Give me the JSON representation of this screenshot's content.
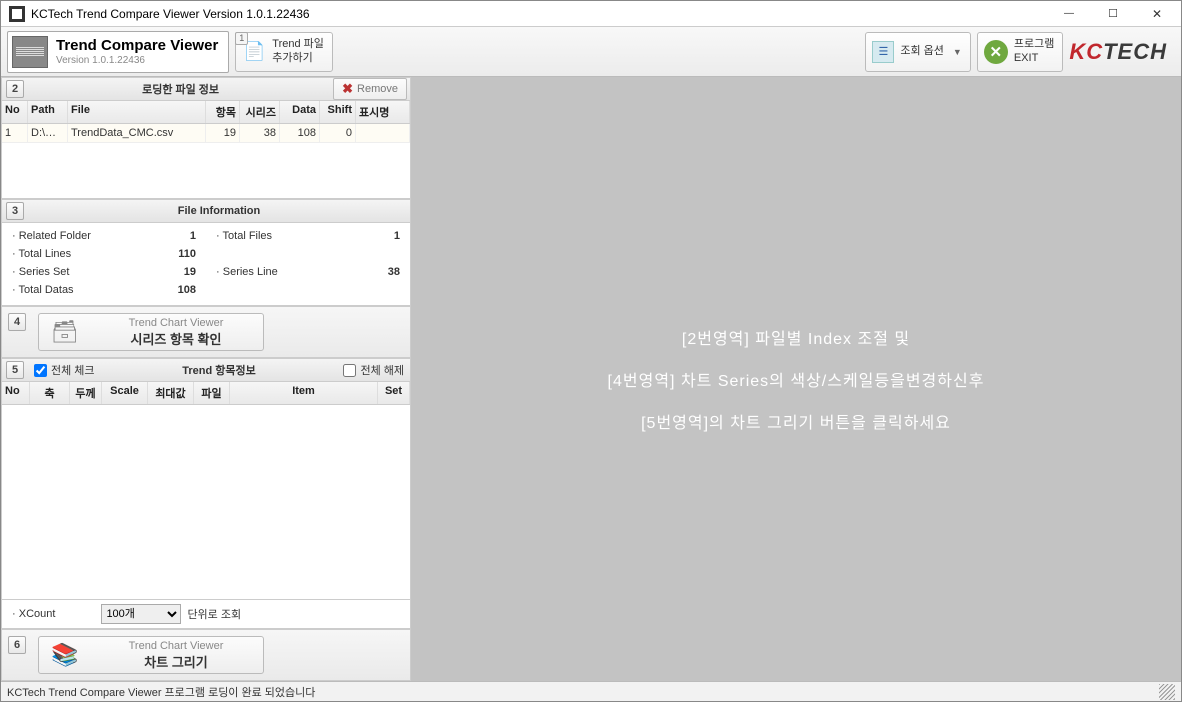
{
  "window": {
    "title": "KCTech Trend Compare Viewer Version 1.0.1.22436"
  },
  "toolbar": {
    "app_title": "Trend Compare Viewer",
    "app_version": "Version 1.0.1.22436",
    "add_file_btn_num": "1",
    "add_file_btn_label": "Trend 파일\n추가하기",
    "option_label": "조회 옵션",
    "exit_label": "프로그램\nEXIT",
    "brand_kc": "KC",
    "brand_tech": "TECH"
  },
  "panel2": {
    "num": "2",
    "title": "로딩한 파일 정보",
    "remove_label": "Remove",
    "headers": {
      "no": "No",
      "path": "Path",
      "file": "File",
      "item": "항목",
      "series": "시리즈",
      "data": "Data",
      "shift": "Shift",
      "display": "표시명"
    },
    "rows": [
      {
        "no": "1",
        "path": "D:\\…",
        "file": "TrendData_CMC.csv",
        "item": "19",
        "series": "38",
        "data": "108",
        "shift": "0",
        "display": ""
      }
    ]
  },
  "panel3": {
    "num": "3",
    "title": "File Information",
    "items": {
      "related_folder_label": "Related Folder",
      "related_folder_val": "1",
      "total_files_label": "Total Files",
      "total_files_val": "1",
      "total_lines_label": "Total Lines",
      "total_lines_val": "110",
      "series_set_label": "Series Set",
      "series_set_val": "19",
      "series_line_label": "Series Line",
      "series_line_val": "38",
      "total_datas_label": "Total Datas",
      "total_datas_val": "108"
    }
  },
  "panel4": {
    "num": "4",
    "viewer_label": "Trend Chart Viewer",
    "action_label": "시리즈 항목 확인"
  },
  "panel5": {
    "num": "5",
    "title": "Trend 항목정보",
    "check_all_label": "전체 체크",
    "uncheck_all_label": "전체 해제",
    "headers": {
      "no": "No",
      "axis": "축",
      "thickness": "두께",
      "scale": "Scale",
      "max": "최대값",
      "file": "파일",
      "item": "Item",
      "set": "Set"
    }
  },
  "xcount": {
    "label": "XCount",
    "selected": "100개",
    "suffix": "단위로 조회"
  },
  "panel6": {
    "num": "6",
    "viewer_label": "Trend Chart Viewer",
    "action_label": "차트 그리기"
  },
  "main_hints": {
    "line1": "[2번영역] 파일별 Index 조절 및",
    "line2": "[4번영역] 차트 Series의 색상/스케일등을변경하신후",
    "line3": "[5번영역]의 차트 그리기 버튼을 클릭하세요"
  },
  "statusbar": {
    "text": "KCTech Trend Compare Viewer 프로그램 로딩이 완료 되었습니다"
  }
}
